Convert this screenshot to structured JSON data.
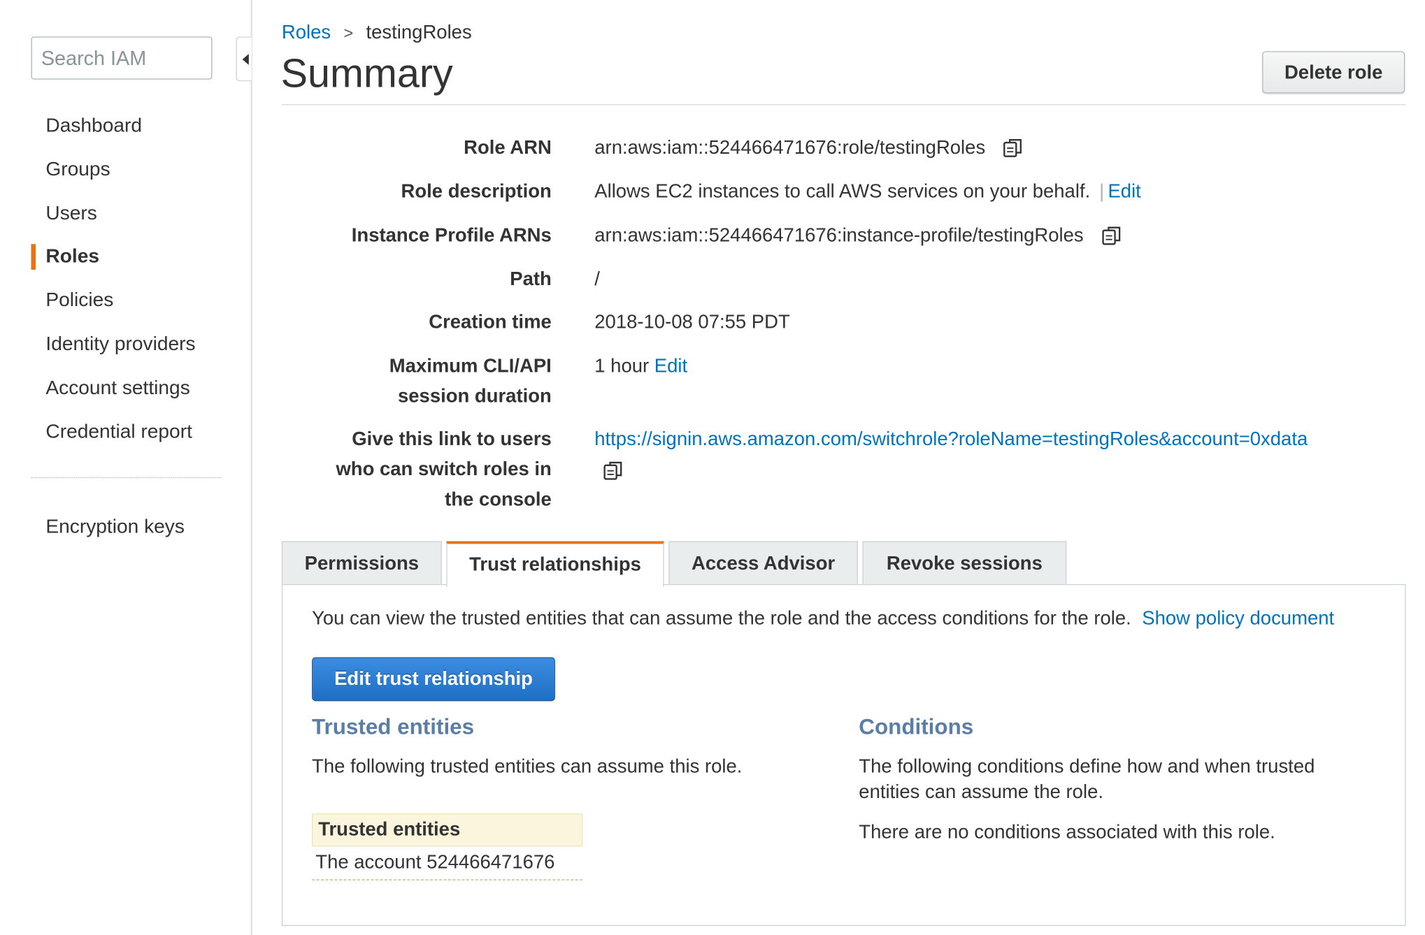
{
  "sidebar": {
    "search_placeholder": "Search IAM",
    "items": [
      {
        "label": "Dashboard"
      },
      {
        "label": "Groups"
      },
      {
        "label": "Users"
      },
      {
        "label": "Roles",
        "active": true
      },
      {
        "label": "Policies"
      },
      {
        "label": "Identity providers"
      },
      {
        "label": "Account settings"
      },
      {
        "label": "Credential report"
      }
    ],
    "extra_items": [
      {
        "label": "Encryption keys"
      }
    ]
  },
  "breadcrumb": {
    "parent": "Roles",
    "separator": ">",
    "current": "testingRoles"
  },
  "header": {
    "title": "Summary",
    "delete_label": "Delete role"
  },
  "summary": {
    "role_arn": {
      "label": "Role ARN",
      "value": "arn:aws:iam::524466471676:role/testingRoles"
    },
    "role_description": {
      "label": "Role description",
      "value": "Allows EC2 instances to call AWS services on your behalf.",
      "pipe": "|",
      "edit": "Edit"
    },
    "instance_profile": {
      "label": "Instance Profile ARNs",
      "value": "arn:aws:iam::524466471676:instance-profile/testingRoles"
    },
    "path": {
      "label": "Path",
      "value": "/"
    },
    "creation_time": {
      "label": "Creation time",
      "value": "2018-10-08 07:55 PDT"
    },
    "max_session": {
      "label_line1": "Maximum CLI/API",
      "label_line2": "session duration",
      "value": "1 hour",
      "edit": "Edit"
    },
    "switch_link": {
      "label_line1": "Give this link to users",
      "label_line2": "who can switch roles in",
      "label_line3": "the console",
      "value": "https://signin.aws.amazon.com/switchrole?roleName=testingRoles&account=0xdata"
    }
  },
  "tabs": [
    {
      "label": "Permissions"
    },
    {
      "label": "Trust relationships",
      "active": true
    },
    {
      "label": "Access Advisor"
    },
    {
      "label": "Revoke sessions"
    }
  ],
  "trust": {
    "intro": "You can view the trusted entities that can assume the role and the access conditions for the role.",
    "show_policy": "Show policy document",
    "edit_button": "Edit trust relationship",
    "entities_heading": "Trusted entities",
    "entities_text": "The following trusted entities can assume this role.",
    "table_header": "Trusted entities",
    "table_rows": [
      "The account 524466471676"
    ],
    "conditions_heading": "Conditions",
    "conditions_text": "The following conditions define how and when trusted entities can assume the role.",
    "no_conditions": "There are no conditions associated with this role."
  },
  "colors": {
    "accent": "#ec7211",
    "link": "#0073bb",
    "primary_button": "#1f6fc5",
    "section_heading": "#5a7ea6"
  }
}
